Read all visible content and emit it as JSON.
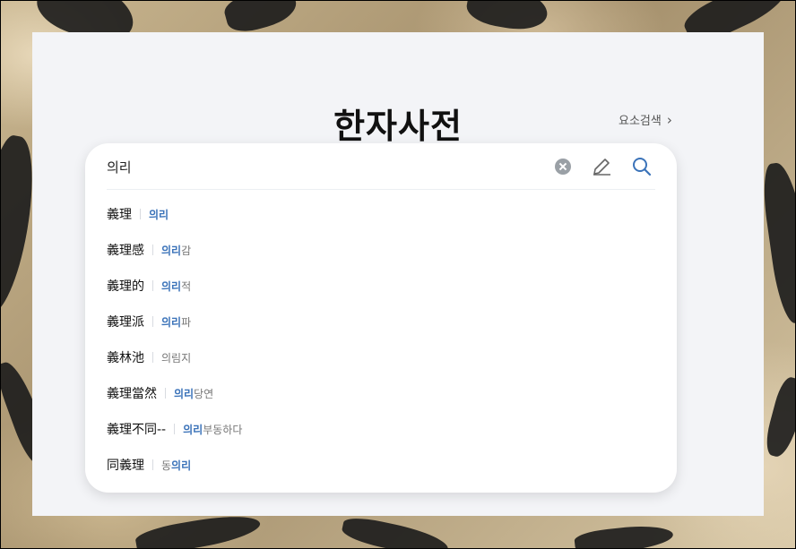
{
  "page": {
    "title": "한자사전",
    "element_search_label": "요소검색"
  },
  "search": {
    "value": "의리"
  },
  "suggestions": [
    {
      "hanja": "義理",
      "hl": "의리",
      "rest": ""
    },
    {
      "hanja": "義理感",
      "hl": "의리",
      "rest": "감"
    },
    {
      "hanja": "義理的",
      "hl": "의리",
      "rest": "적"
    },
    {
      "hanja": "義理派",
      "hl": "의리",
      "rest": "파"
    },
    {
      "hanja": "義林池",
      "hl": "",
      "rest": "의림지"
    },
    {
      "hanja": "義理當然",
      "hl": "의리",
      "rest": "당연"
    },
    {
      "hanja": "義理不同--",
      "hl": "의리",
      "rest": "부동하다"
    },
    {
      "hanja": "同義理",
      "pre": "동",
      "hl": "의리",
      "rest": ""
    }
  ],
  "colors": {
    "highlight": "#3b73b9",
    "panel_bg": "#f3f4f7"
  }
}
